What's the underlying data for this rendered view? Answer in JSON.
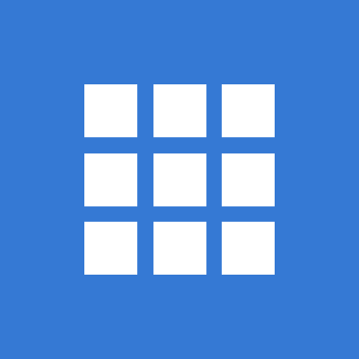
{
  "icon": {
    "name": "apps-grid-icon",
    "background_color": "#3579D4",
    "tile_color": "#FFFFFF",
    "rows": 3,
    "columns": 3
  }
}
